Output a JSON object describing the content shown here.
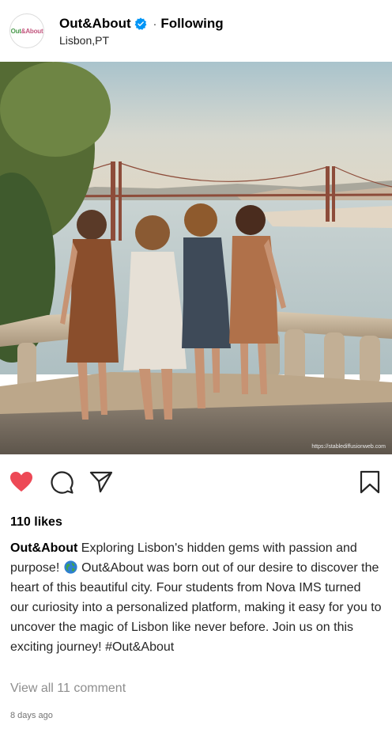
{
  "post": {
    "account": {
      "avatar_text_a": "Out",
      "avatar_text_b": "&About",
      "username": "Out&About",
      "verified_icon": "verified-badge-icon",
      "separator": "·",
      "follow_status": "Following",
      "location": "Lisbon,PT"
    },
    "photo": {
      "watermark": "https://stablediffusionweb.com"
    },
    "actions": {
      "like_icon": "heart-filled-icon",
      "comment_icon": "comment-icon",
      "share_icon": "share-icon",
      "save_icon": "bookmark-icon"
    },
    "likes": "110 likes",
    "caption": {
      "username": "Out&About",
      "text_before_emoji": "Exploring Lisbon's hidden gems with passion and purpose!",
      "emoji": "globe-icon",
      "text_after_emoji": "Out&About was born out of our desire to discover the heart of this beautiful city. Four students from Nova IMS turned our curiosity into a personalized platform, making it easy for you to uncover the magic of Lisbon like never before. Join us on this exciting journey! #Out&About"
    },
    "view_comments": "View all 11 comment",
    "timestamp": "8 days ago"
  },
  "colors": {
    "like_red": "#ed4956",
    "verified_blue": "#0095f6",
    "muted_text": "#8e8e8e"
  }
}
